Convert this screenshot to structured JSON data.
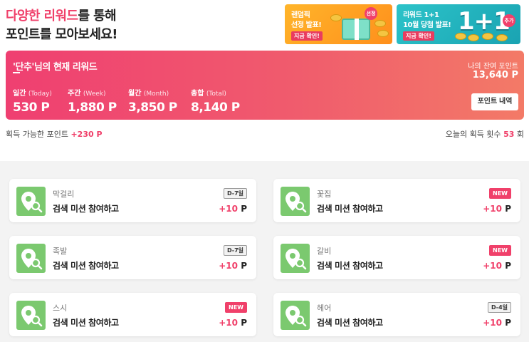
{
  "header": {
    "line1_accent": "다양한 리워드",
    "line1_rest": "를 통해",
    "line2": "포인트를 모아보세요!"
  },
  "banners": [
    {
      "line1": "랜덤픽",
      "line2": "선정 발표!",
      "button": "지금 확인!",
      "badge": "선정"
    },
    {
      "line1": "리워드 1+1",
      "line2": "10월 당첨 발표!",
      "button": "지금 확인!",
      "big": "1+1",
      "badge": "추가"
    }
  ],
  "reward": {
    "user": "'단추'",
    "title_rest": "님의 현재 리워드",
    "stats": [
      {
        "label": "일간",
        "label_en": "(Today)",
        "value": "530 P"
      },
      {
        "label": "주간",
        "label_en": "(Week)",
        "value": "1,880 P"
      },
      {
        "label": "월간",
        "label_en": "(Month)",
        "value": "3,850 P"
      },
      {
        "label": "총합",
        "label_en": "(Total)",
        "value": "8,140 P"
      }
    ],
    "balance_label": "나의 잔여 포인트",
    "balance_value": "13,640 P",
    "history_button": "포인트 내역"
  },
  "summary": {
    "available_label": "획득 가능한 포인트",
    "available_value": "+230 P",
    "today_label": "오늘의 획득 횟수",
    "today_count": "53",
    "today_unit": "회"
  },
  "missions": [
    {
      "category": "막걸리",
      "title": "검색 미션 참여하고",
      "badge": "D-7일",
      "badge_type": "d",
      "points": "+10",
      "unit": "P"
    },
    {
      "category": "꽃집",
      "title": "검색 미션 참여하고",
      "badge": "NEW",
      "badge_type": "new",
      "points": "+10",
      "unit": "P"
    },
    {
      "category": "족발",
      "title": "검색 미션 참여하고",
      "badge": "D-7일",
      "badge_type": "d",
      "points": "+10",
      "unit": "P"
    },
    {
      "category": "갈비",
      "title": "검색 미션 참여하고",
      "badge": "NEW",
      "badge_type": "new",
      "points": "+10",
      "unit": "P"
    },
    {
      "category": "스시",
      "title": "검색 미션 참여하고",
      "badge": "NEW",
      "badge_type": "new",
      "points": "+10",
      "unit": "P"
    },
    {
      "category": "헤어",
      "title": "검색 미션 참여하고",
      "badge": "D-4일",
      "badge_type": "d",
      "points": "+10",
      "unit": "P"
    }
  ],
  "colors": {
    "accent": "#f0406a",
    "map_icon": "#7bc96f"
  },
  "icons": {
    "mission": "map-pin-search-icon"
  }
}
